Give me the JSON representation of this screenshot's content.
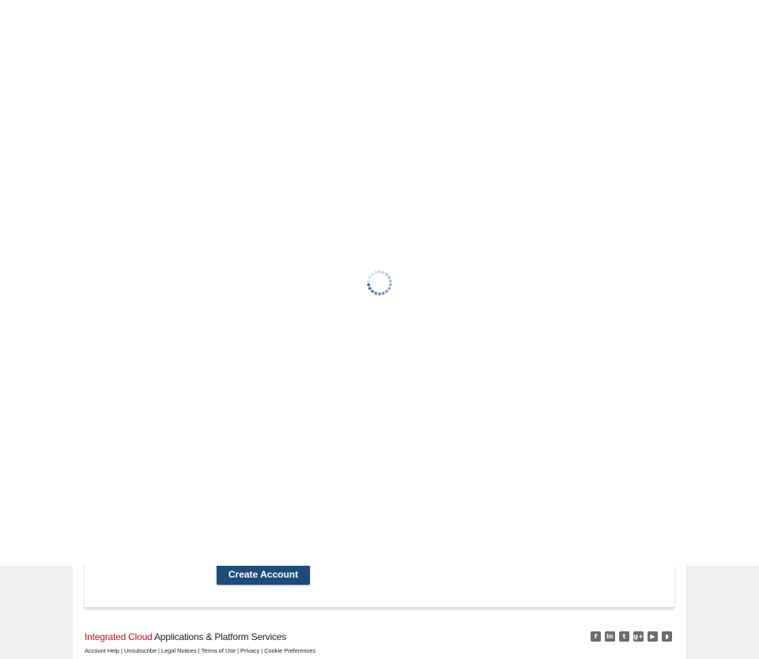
{
  "card": {
    "create_account_label": "Create Account"
  },
  "footer": {
    "brand_accent": "Integrated Cloud",
    "brand_rest": " Applications & Platform Services",
    "links": [
      "Account Help",
      "Unsubscribe",
      "Legal Notices",
      "Terms of Use",
      "Privacy",
      "Cookie Preferences"
    ],
    "separator": "|"
  },
  "social": {
    "icons": [
      "facebook-icon",
      "linkedin-icon",
      "twitter-icon",
      "google-plus-icon",
      "youtube-icon",
      "rss-icon"
    ],
    "glyphs": [
      "f",
      "in",
      "t",
      "g+",
      "▶",
      "◗"
    ]
  },
  "colors": {
    "brand_accent": "#c8102e",
    "button": "#1c4b7c",
    "spinner": "#2a5f9e"
  }
}
